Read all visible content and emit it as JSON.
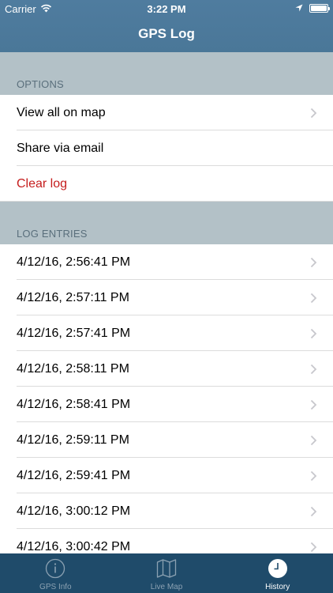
{
  "status_bar": {
    "carrier": "Carrier",
    "time": "3:22 PM",
    "battery_level": 1.0
  },
  "navbar": {
    "title": "GPS Log"
  },
  "options": {
    "header": "OPTIONS",
    "items": [
      {
        "label": "View all on map",
        "has_chevron": true
      },
      {
        "label": "Share via email",
        "has_chevron": false
      },
      {
        "label": "Clear log",
        "has_chevron": false,
        "destructive": true
      }
    ]
  },
  "log_entries": {
    "header": "LOG ENTRIES",
    "items": [
      "4/12/16, 2:56:41 PM",
      "4/12/16, 2:57:11 PM",
      "4/12/16, 2:57:41 PM",
      "4/12/16, 2:58:11 PM",
      "4/12/16, 2:58:41 PM",
      "4/12/16, 2:59:11 PM",
      "4/12/16, 2:59:41 PM",
      "4/12/16, 3:00:12 PM",
      "4/12/16, 3:00:42 PM"
    ]
  },
  "tabbar": {
    "tabs": [
      {
        "label": "GPS Info",
        "icon": "info-icon",
        "active": false
      },
      {
        "label": "Live Map",
        "icon": "map-icon",
        "active": false
      },
      {
        "label": "History",
        "icon": "clock-icon",
        "active": true
      }
    ]
  },
  "colors": {
    "navbar": "#4a7798",
    "section_header": "#b3c1c7",
    "destructive": "#c51d1d",
    "tabbar": "#1f4b6a"
  }
}
